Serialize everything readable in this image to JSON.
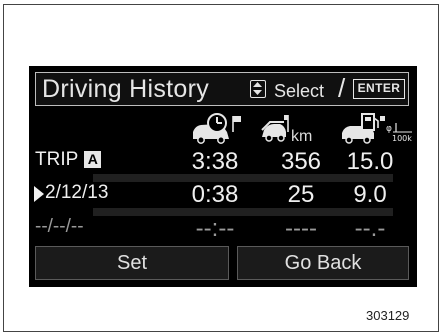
{
  "header": {
    "title": "Driving History",
    "select_label": "Select",
    "slash": "/",
    "enter_label": "ENTER"
  },
  "columns": [
    {
      "icon": "car-clock-icon",
      "unit": ""
    },
    {
      "icon": "car-distance-icon",
      "unit": "km"
    },
    {
      "icon": "car-fuel-economy-icon",
      "unit": "φ/100km"
    }
  ],
  "rows": [
    {
      "label": "TRIP",
      "badge": "A",
      "time": "3:38",
      "distance": "356",
      "fuel": "15.0",
      "selected": false
    },
    {
      "label": "2/12/13",
      "time": "0:38",
      "distance": "25",
      "fuel": "9.0",
      "selected": true
    },
    {
      "label": "--/--/--",
      "time": "--:--",
      "distance": "----",
      "fuel": "--.-",
      "selected": false
    }
  ],
  "buttons": {
    "set": "Set",
    "go_back": "Go Back"
  },
  "figure_code": "303129",
  "colors": {
    "screen_bg": "#000000",
    "text": "#efefef",
    "placeholder_text": "#9a9a9a"
  }
}
